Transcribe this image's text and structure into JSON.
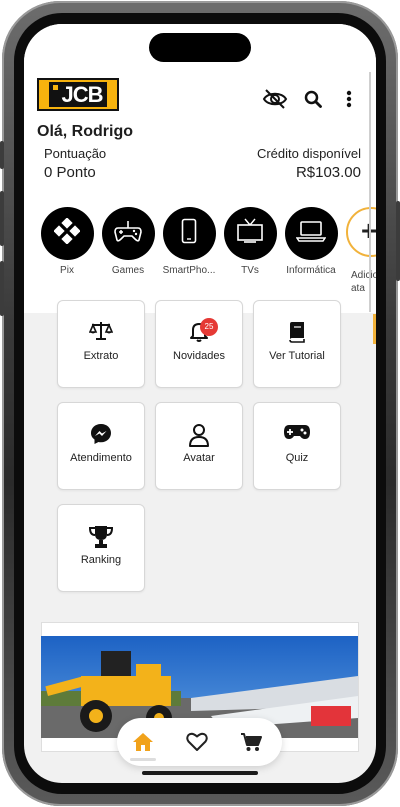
{
  "header": {
    "logo_text": "JCB",
    "greeting": "Olá, Rodrigo",
    "points_label": "Pontuação",
    "points_value": "0 Ponto",
    "credit_label": "Crédito disponível",
    "credit_value": "R$103.00",
    "icons": [
      "eye-off-icon",
      "search-icon",
      "more-vertical-icon"
    ]
  },
  "categories": [
    {
      "label": "Pix",
      "icon": "pix-icon"
    },
    {
      "label": "Games",
      "icon": "gamepad-icon"
    },
    {
      "label": "SmartPho...",
      "icon": "smartphone-icon"
    },
    {
      "label": "TVs",
      "icon": "tv-icon"
    },
    {
      "label": "Informática",
      "icon": "laptop-icon"
    }
  ],
  "add_category": {
    "label_line1": "Adicio",
    "label_line2": "ata"
  },
  "tiles": [
    {
      "label": "Extrato",
      "icon": "scale-icon"
    },
    {
      "label": "Novidades",
      "icon": "bell-icon",
      "badge": "25"
    },
    {
      "label": "Ver Tutorial",
      "icon": "book-icon"
    },
    {
      "label": "Atendimento",
      "icon": "messenger-icon"
    },
    {
      "label": "Avatar",
      "icon": "user-icon"
    },
    {
      "label": "Quiz",
      "icon": "gamepad-icon"
    },
    {
      "label": "Ranking",
      "icon": "trophy-icon"
    }
  ],
  "bottom_nav": [
    {
      "icon": "home-icon",
      "active": true
    },
    {
      "icon": "heart-icon",
      "active": false
    },
    {
      "icon": "cart-icon",
      "active": false
    }
  ],
  "colors": {
    "accent": "#f1b23b",
    "logo_yellow": "#f7b30e",
    "badge_red": "#e53935"
  }
}
